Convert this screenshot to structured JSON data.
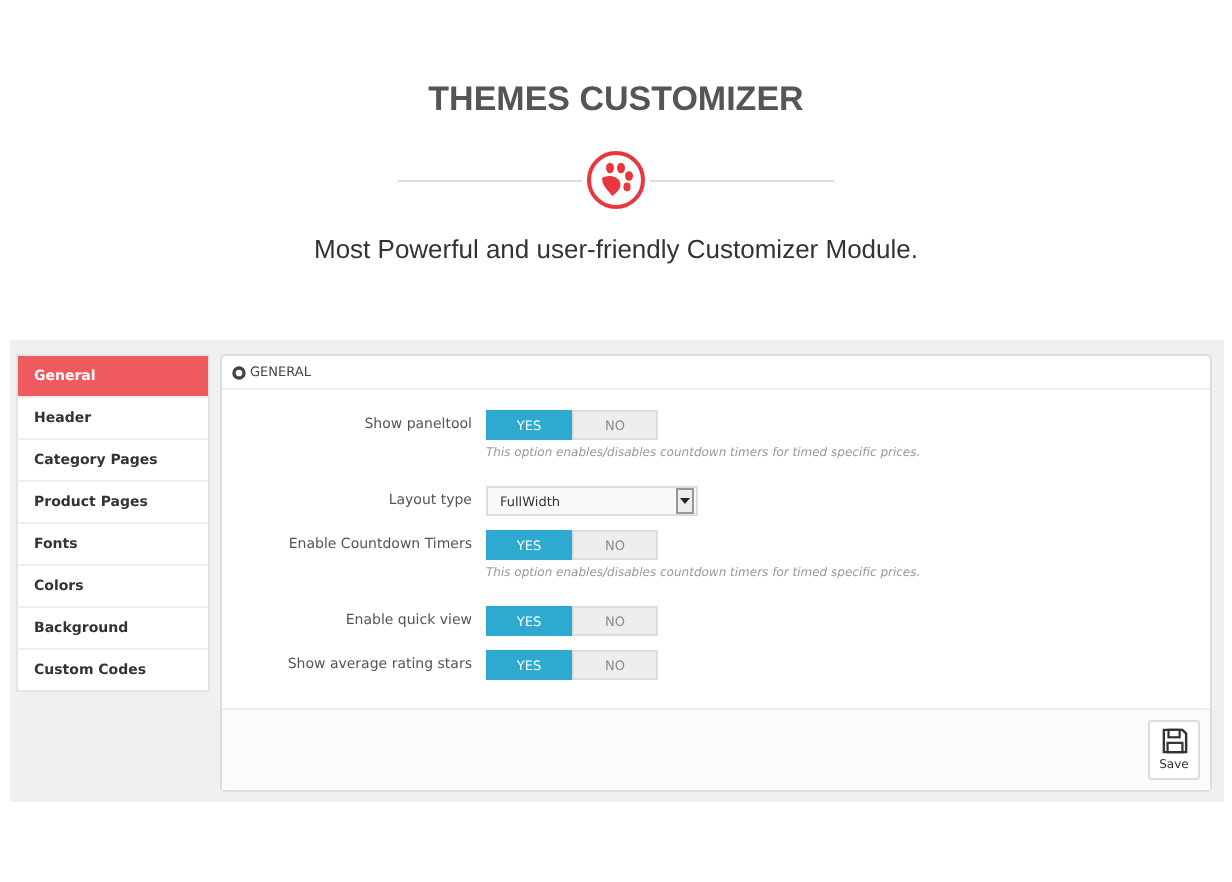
{
  "header": {
    "title": "THEMES CUSTOMIZER",
    "subtitle": "Most Powerful and user-friendly Customizer Module."
  },
  "sidebar": {
    "items": [
      {
        "label": "General",
        "selected": true
      },
      {
        "label": "Header",
        "selected": false
      },
      {
        "label": "Category Pages",
        "selected": false
      },
      {
        "label": "Product Pages",
        "selected": false
      },
      {
        "label": "Fonts",
        "selected": false
      },
      {
        "label": "Colors",
        "selected": false
      },
      {
        "label": "Background",
        "selected": false
      },
      {
        "label": "Custom Codes",
        "selected": false
      }
    ]
  },
  "panel": {
    "title": "GENERAL",
    "settings": [
      {
        "kind": "toggle",
        "label": "Show paneltool",
        "options": [
          {
            "label": "YES",
            "selected": true
          },
          {
            "label": "NO",
            "selected": false
          }
        ],
        "help": "This option enables/disables countdown timers for timed specific prices."
      },
      {
        "kind": "select",
        "label": "Layout type",
        "value": "FullWidth"
      },
      {
        "kind": "toggle",
        "label": "Enable Countdown Timers",
        "options": [
          {
            "label": "YES",
            "selected": true
          },
          {
            "label": "NO",
            "selected": false
          }
        ],
        "help": "This option enables/disables countdown timers for timed specific prices."
      },
      {
        "kind": "toggle",
        "label": "Enable quick view",
        "options": [
          {
            "label": "YES",
            "selected": true
          },
          {
            "label": "NO",
            "selected": false
          }
        ]
      },
      {
        "kind": "toggle",
        "label": "Show average rating stars",
        "options": [
          {
            "label": "YES",
            "selected": true
          },
          {
            "label": "NO",
            "selected": false
          }
        ]
      }
    ],
    "save_button": "Save"
  }
}
